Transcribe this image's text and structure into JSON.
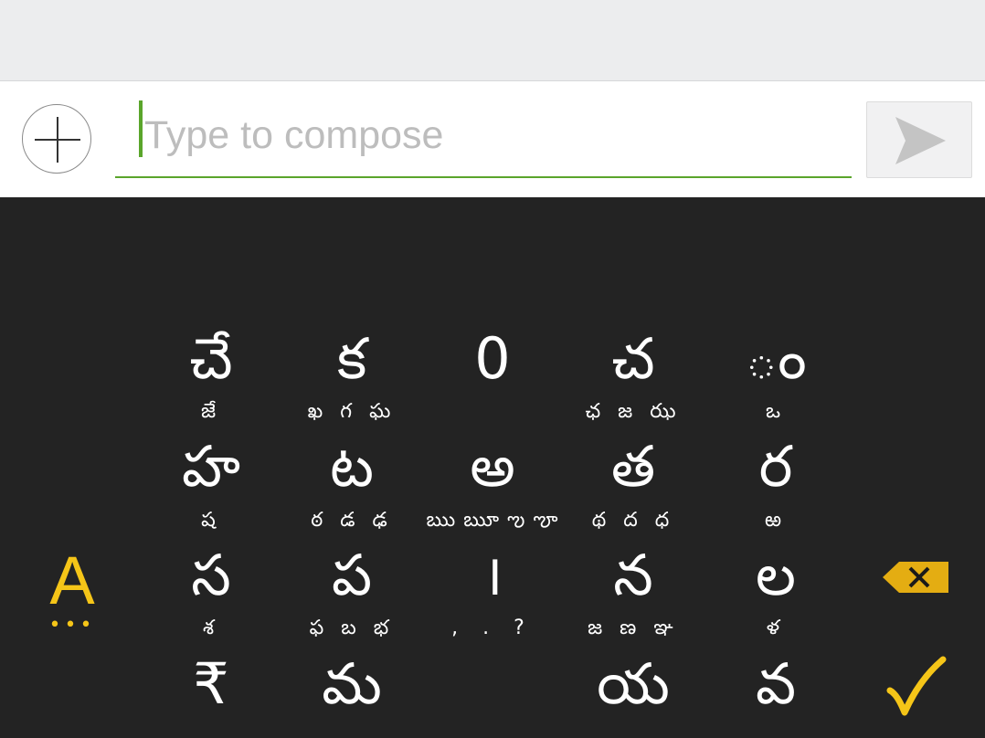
{
  "compose": {
    "placeholder": "Type to compose",
    "value": ""
  },
  "colors": {
    "accent": "#5aa52b",
    "keyboard_bg": "#232323",
    "key_text": "#ffffff",
    "function_key": "#f5c518"
  },
  "icons": {
    "add": "plus-circle-icon",
    "send": "send-arrow-icon",
    "backspace": "backspace-icon",
    "enter": "checkmark-icon",
    "language": "language-switch-icon"
  },
  "keyboard": {
    "language_label": "A",
    "language_dots": "•••",
    "rows": [
      {
        "keys": [
          {
            "main": "చే",
            "hint": "జే"
          },
          {
            "main": "క",
            "hint": "ఖ గ ఘ"
          },
          {
            "main": "0",
            "hint": ""
          },
          {
            "main": "చ",
            "hint": "ఛ జ ఝ"
          },
          {
            "main": "ం",
            "hint": "ఒ"
          }
        ]
      },
      {
        "keys": [
          {
            "main": "హ",
            "hint": "ష"
          },
          {
            "main": "ట",
            "hint": "ఠ డ ఢ"
          },
          {
            "main": "అ",
            "hint": "ఋ ౠ ఌ ౡ"
          },
          {
            "main": "త",
            "hint": "థ ద ధ"
          },
          {
            "main": "ర",
            "hint": "ఱ"
          }
        ]
      },
      {
        "keys": [
          {
            "main": "స",
            "hint": "శ"
          },
          {
            "main": "ప",
            "hint": "ఫ బ భ"
          },
          {
            "main": "।",
            "hint": ", . ?"
          },
          {
            "main": "న",
            "hint": "జ ణ ఞ"
          },
          {
            "main": "ల",
            "hint": "ళ"
          }
        ]
      },
      {
        "keys": [
          {
            "main": "₹",
            "hint": ""
          },
          {
            "main": "మ",
            "hint": ""
          },
          {
            "main": "",
            "hint": ""
          },
          {
            "main": "య",
            "hint": ""
          },
          {
            "main": "వ",
            "hint": ""
          }
        ]
      }
    ]
  }
}
